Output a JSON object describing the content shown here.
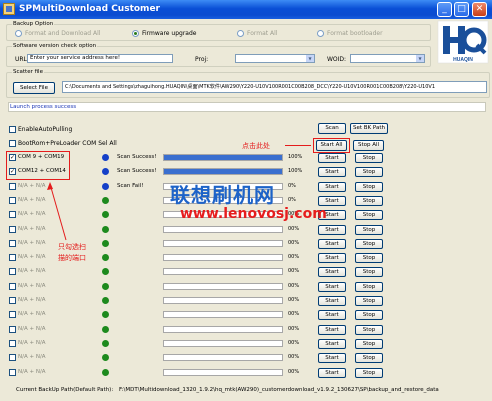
{
  "window": {
    "title": "SPMultiDownload Customer"
  },
  "backup": {
    "group_label": "Backup Option",
    "options": [
      {
        "label": "Format and Download All",
        "selected": false,
        "enabled": false
      },
      {
        "label": "Firmware upgrade",
        "selected": true,
        "enabled": true
      },
      {
        "label": "Format All",
        "selected": false,
        "enabled": false
      },
      {
        "label": "Format bootloader",
        "selected": false,
        "enabled": false
      }
    ]
  },
  "version_check": {
    "group_label": "Software version check option",
    "url_label": "URL:",
    "url_value": "Enter your service address here!",
    "proj_label": "Proj:",
    "proj_value": "",
    "woid_label": "WOID:",
    "woid_value": ""
  },
  "logo": {
    "brand": "HQ",
    "name": "HUAQIN"
  },
  "scatter": {
    "group_label": "Scatter file",
    "select_button": "Select File",
    "path": "C:\\Documents and Settings\\zhaguihong.HUAQIN\\桌面\\MTK软件\\AW290\\Y220-U10V100R001C00B208_DCC\\Y220-U10V100R001C00B208\\Y220-U10V1"
  },
  "status_line": "Launch process success",
  "options": {
    "auto_polling": {
      "label": "EnableAutoPulling",
      "checked": false
    },
    "bootrom": {
      "label": "BootRom+PreLoader COM Sel All",
      "checked": false
    }
  },
  "buttons": {
    "scan": "Scan",
    "set_bk_path": "Set BK Path",
    "start_all": "Start All",
    "stop_all": "Stop All",
    "start": "Start",
    "stop": "Stop"
  },
  "ports": [
    {
      "label": "COM 9 + COM19",
      "checked": true,
      "status": "Scan Success!",
      "progress": 100,
      "percent": "100%",
      "dot": "#1540c8"
    },
    {
      "label": "COM12 + COM14",
      "checked": true,
      "status": "Scan Success!",
      "progress": 100,
      "percent": "100%",
      "dot": "#1540c8"
    },
    {
      "label": "N/A + N/A",
      "checked": false,
      "status": "Scan Fail!",
      "progress": 0,
      "percent": "0%",
      "dot": "#1540c8"
    },
    {
      "label": "N/A + N/A",
      "checked": false,
      "status": "",
      "progress": 0,
      "percent": "0%",
      "dot": "#1d8a1d"
    },
    {
      "label": "N/A + N/A",
      "checked": false,
      "status": "",
      "progress": 0,
      "percent": "00%",
      "dot": "#1d8a1d"
    },
    {
      "label": "N/A + N/A",
      "checked": false,
      "status": "",
      "progress": 0,
      "percent": "00%",
      "dot": "#1d8a1d"
    },
    {
      "label": "N/A + N/A",
      "checked": false,
      "status": "",
      "progress": 0,
      "percent": "00%",
      "dot": "#1d8a1d"
    },
    {
      "label": "N/A + N/A",
      "checked": false,
      "status": "",
      "progress": 0,
      "percent": "00%",
      "dot": "#1d8a1d"
    },
    {
      "label": "N/A + N/A",
      "checked": false,
      "status": "",
      "progress": 0,
      "percent": "00%",
      "dot": "#1d8a1d"
    },
    {
      "label": "N/A + N/A",
      "checked": false,
      "status": "",
      "progress": 0,
      "percent": "00%",
      "dot": "#1d8a1d"
    },
    {
      "label": "N/A + N/A",
      "checked": false,
      "status": "",
      "progress": 0,
      "percent": "00%",
      "dot": "#1d8a1d"
    },
    {
      "label": "N/A + N/A",
      "checked": false,
      "status": "",
      "progress": 0,
      "percent": "00%",
      "dot": "#1d8a1d"
    },
    {
      "label": "N/A + N/A",
      "checked": false,
      "status": "",
      "progress": 0,
      "percent": "00%",
      "dot": "#1d8a1d"
    },
    {
      "label": "N/A + N/A",
      "checked": false,
      "status": "",
      "progress": 0,
      "percent": "00%",
      "dot": "#1d8a1d"
    },
    {
      "label": "N/A + N/A",
      "checked": false,
      "status": "",
      "progress": 0,
      "percent": "00%",
      "dot": "#1d8a1d"
    },
    {
      "label": "N/A + N/A",
      "checked": false,
      "status": "",
      "progress": 0,
      "percent": "00%",
      "dot": "#1d8a1d"
    }
  ],
  "annotations": {
    "click_here": "点击此处",
    "check_ports_line1": "只勾选扫",
    "check_ports_line2": "描的端口",
    "watermark_cn": "联想刷机网",
    "watermark_url": "www.lenovosj.com"
  },
  "footer": {
    "label": "Current BackUp Path(Default Path):",
    "path": "F:\\MDT\\Multidownload_1320_1.9.2\\hq_mtk(AW290)_customerdownload_v1.9.2_130627\\SP\\backup_and_restore_data"
  },
  "colors": {
    "accent": "#0a4fd6",
    "progress": "#3a6fcf",
    "annotation": "#e41c1c",
    "watermark": "#1d63c8"
  }
}
